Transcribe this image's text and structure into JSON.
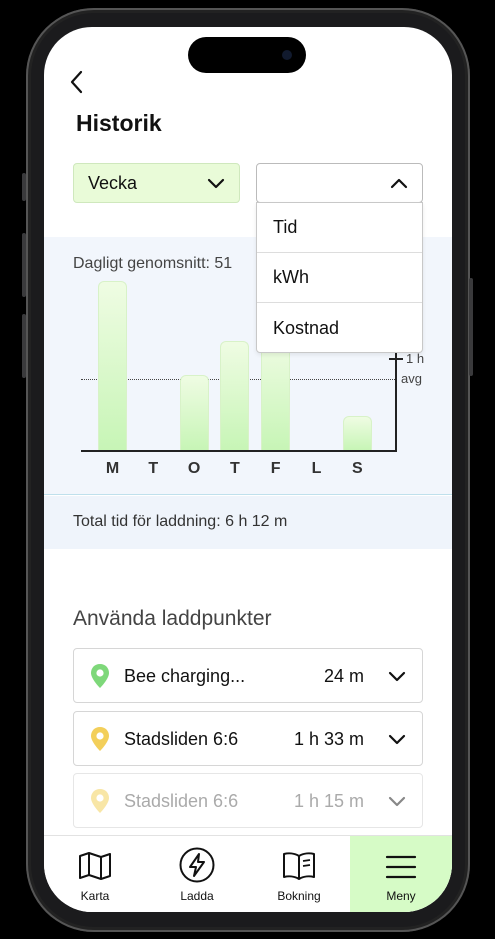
{
  "header": {
    "back_icon": "chevron-left-icon",
    "title": "Historik"
  },
  "filters": {
    "period": {
      "value": "Vecka",
      "icon": "chevron-down-icon"
    },
    "metric": {
      "value": "",
      "icon": "chevron-up-icon",
      "expanded": true,
      "options": [
        "Tid",
        "kWh",
        "Kostnad"
      ]
    }
  },
  "chart_data": {
    "type": "bar",
    "title": "Dagligt genomsnitt: 51",
    "categories": [
      "M",
      "T",
      "O",
      "T",
      "F",
      "L",
      "S"
    ],
    "values": [
      2.25,
      0,
      1.0,
      1.45,
      1.5,
      0,
      0.45
    ],
    "ylim": [
      0,
      2.4
    ],
    "reference_lines": [
      {
        "label": "1 h",
        "value": 1.23
      }
    ],
    "average_label": "avg",
    "average_value": 0.95,
    "peek_unit": "h",
    "grid": false,
    "colors": {
      "bar_top": "#effce3",
      "bar_bottom": "#c7f5b6"
    }
  },
  "summary": {
    "total": "Total tid för laddning: 6 h 12 m"
  },
  "used_points": {
    "title": "Använda laddpunkter",
    "items": [
      {
        "name": "Bee charging...",
        "time": "24 m",
        "pin_color": "#7ed87a",
        "faded": false
      },
      {
        "name": "Stadsliden 6:6",
        "time": "1 h 33 m",
        "pin_color": "#f3cf5a",
        "faded": false
      },
      {
        "name": "Stadsliden 6:6",
        "time": "1 h 15 m",
        "pin_color": "#f8e6a6",
        "faded": true
      }
    ]
  },
  "tabbar": {
    "items": [
      {
        "label": "Karta",
        "icon": "map-icon",
        "active": false
      },
      {
        "label": "Ladda",
        "icon": "charge-bolt-icon",
        "active": false
      },
      {
        "label": "Bokning",
        "icon": "book-icon",
        "active": false
      },
      {
        "label": "Meny",
        "icon": "menu-icon",
        "active": true
      }
    ]
  },
  "colors": {
    "accent": "#d6fbc6",
    "selected_filter": "#e9fbd8"
  }
}
